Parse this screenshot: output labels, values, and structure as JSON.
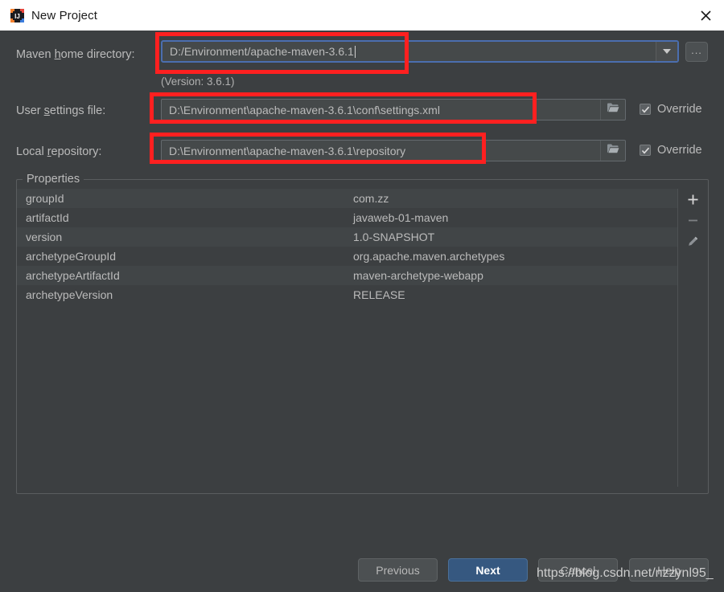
{
  "window": {
    "title": "New Project",
    "app_icon": "intellij-idea-icon",
    "close_icon": "close-icon"
  },
  "form": {
    "maven_home": {
      "label_prefix": "Maven ",
      "label_mnemonic": "h",
      "label_suffix": "ome directory:",
      "value": "D:/Environment/apache-maven-3.6.1",
      "dropdown_icon": "chevron-down-icon",
      "browse_label": "...",
      "version_note": "(Version: 3.6.1)"
    },
    "user_settings": {
      "label_prefix": "User ",
      "label_mnemonic": "s",
      "label_suffix": "ettings file:",
      "value": "D:\\Environment\\apache-maven-3.6.1\\conf\\settings.xml",
      "folder_icon": "folder-icon",
      "override_label": "Override",
      "override_checked": true
    },
    "local_repository": {
      "label_prefix": "Local ",
      "label_mnemonic": "r",
      "label_suffix": "epository:",
      "value": "D:\\Environment\\apache-maven-3.6.1\\repository",
      "folder_icon": "folder-icon",
      "override_label": "Override",
      "override_checked": true
    }
  },
  "properties": {
    "group_title": "Properties",
    "rows": [
      {
        "key": "groupId",
        "value": "com.zz"
      },
      {
        "key": "artifactId",
        "value": "javaweb-01-maven"
      },
      {
        "key": "version",
        "value": "1.0-SNAPSHOT"
      },
      {
        "key": "archetypeGroupId",
        "value": "org.apache.maven.archetypes"
      },
      {
        "key": "archetypeArtifactId",
        "value": "maven-archetype-webapp"
      },
      {
        "key": "archetypeVersion",
        "value": "RELEASE"
      }
    ],
    "toolbar": {
      "add_icon": "plus-icon",
      "remove_icon": "minus-icon",
      "edit_icon": "pencil-icon"
    }
  },
  "footer": {
    "previous": "Previous",
    "next": "Next",
    "cancel": "Cancel",
    "help": "Help"
  },
  "overlay": {
    "watermark": "https://blog.csdn.net/nzzynl95_",
    "highlight_color": "#ff2020",
    "accent_color": "#365880",
    "focus_border_color": "#4b6eaf"
  }
}
